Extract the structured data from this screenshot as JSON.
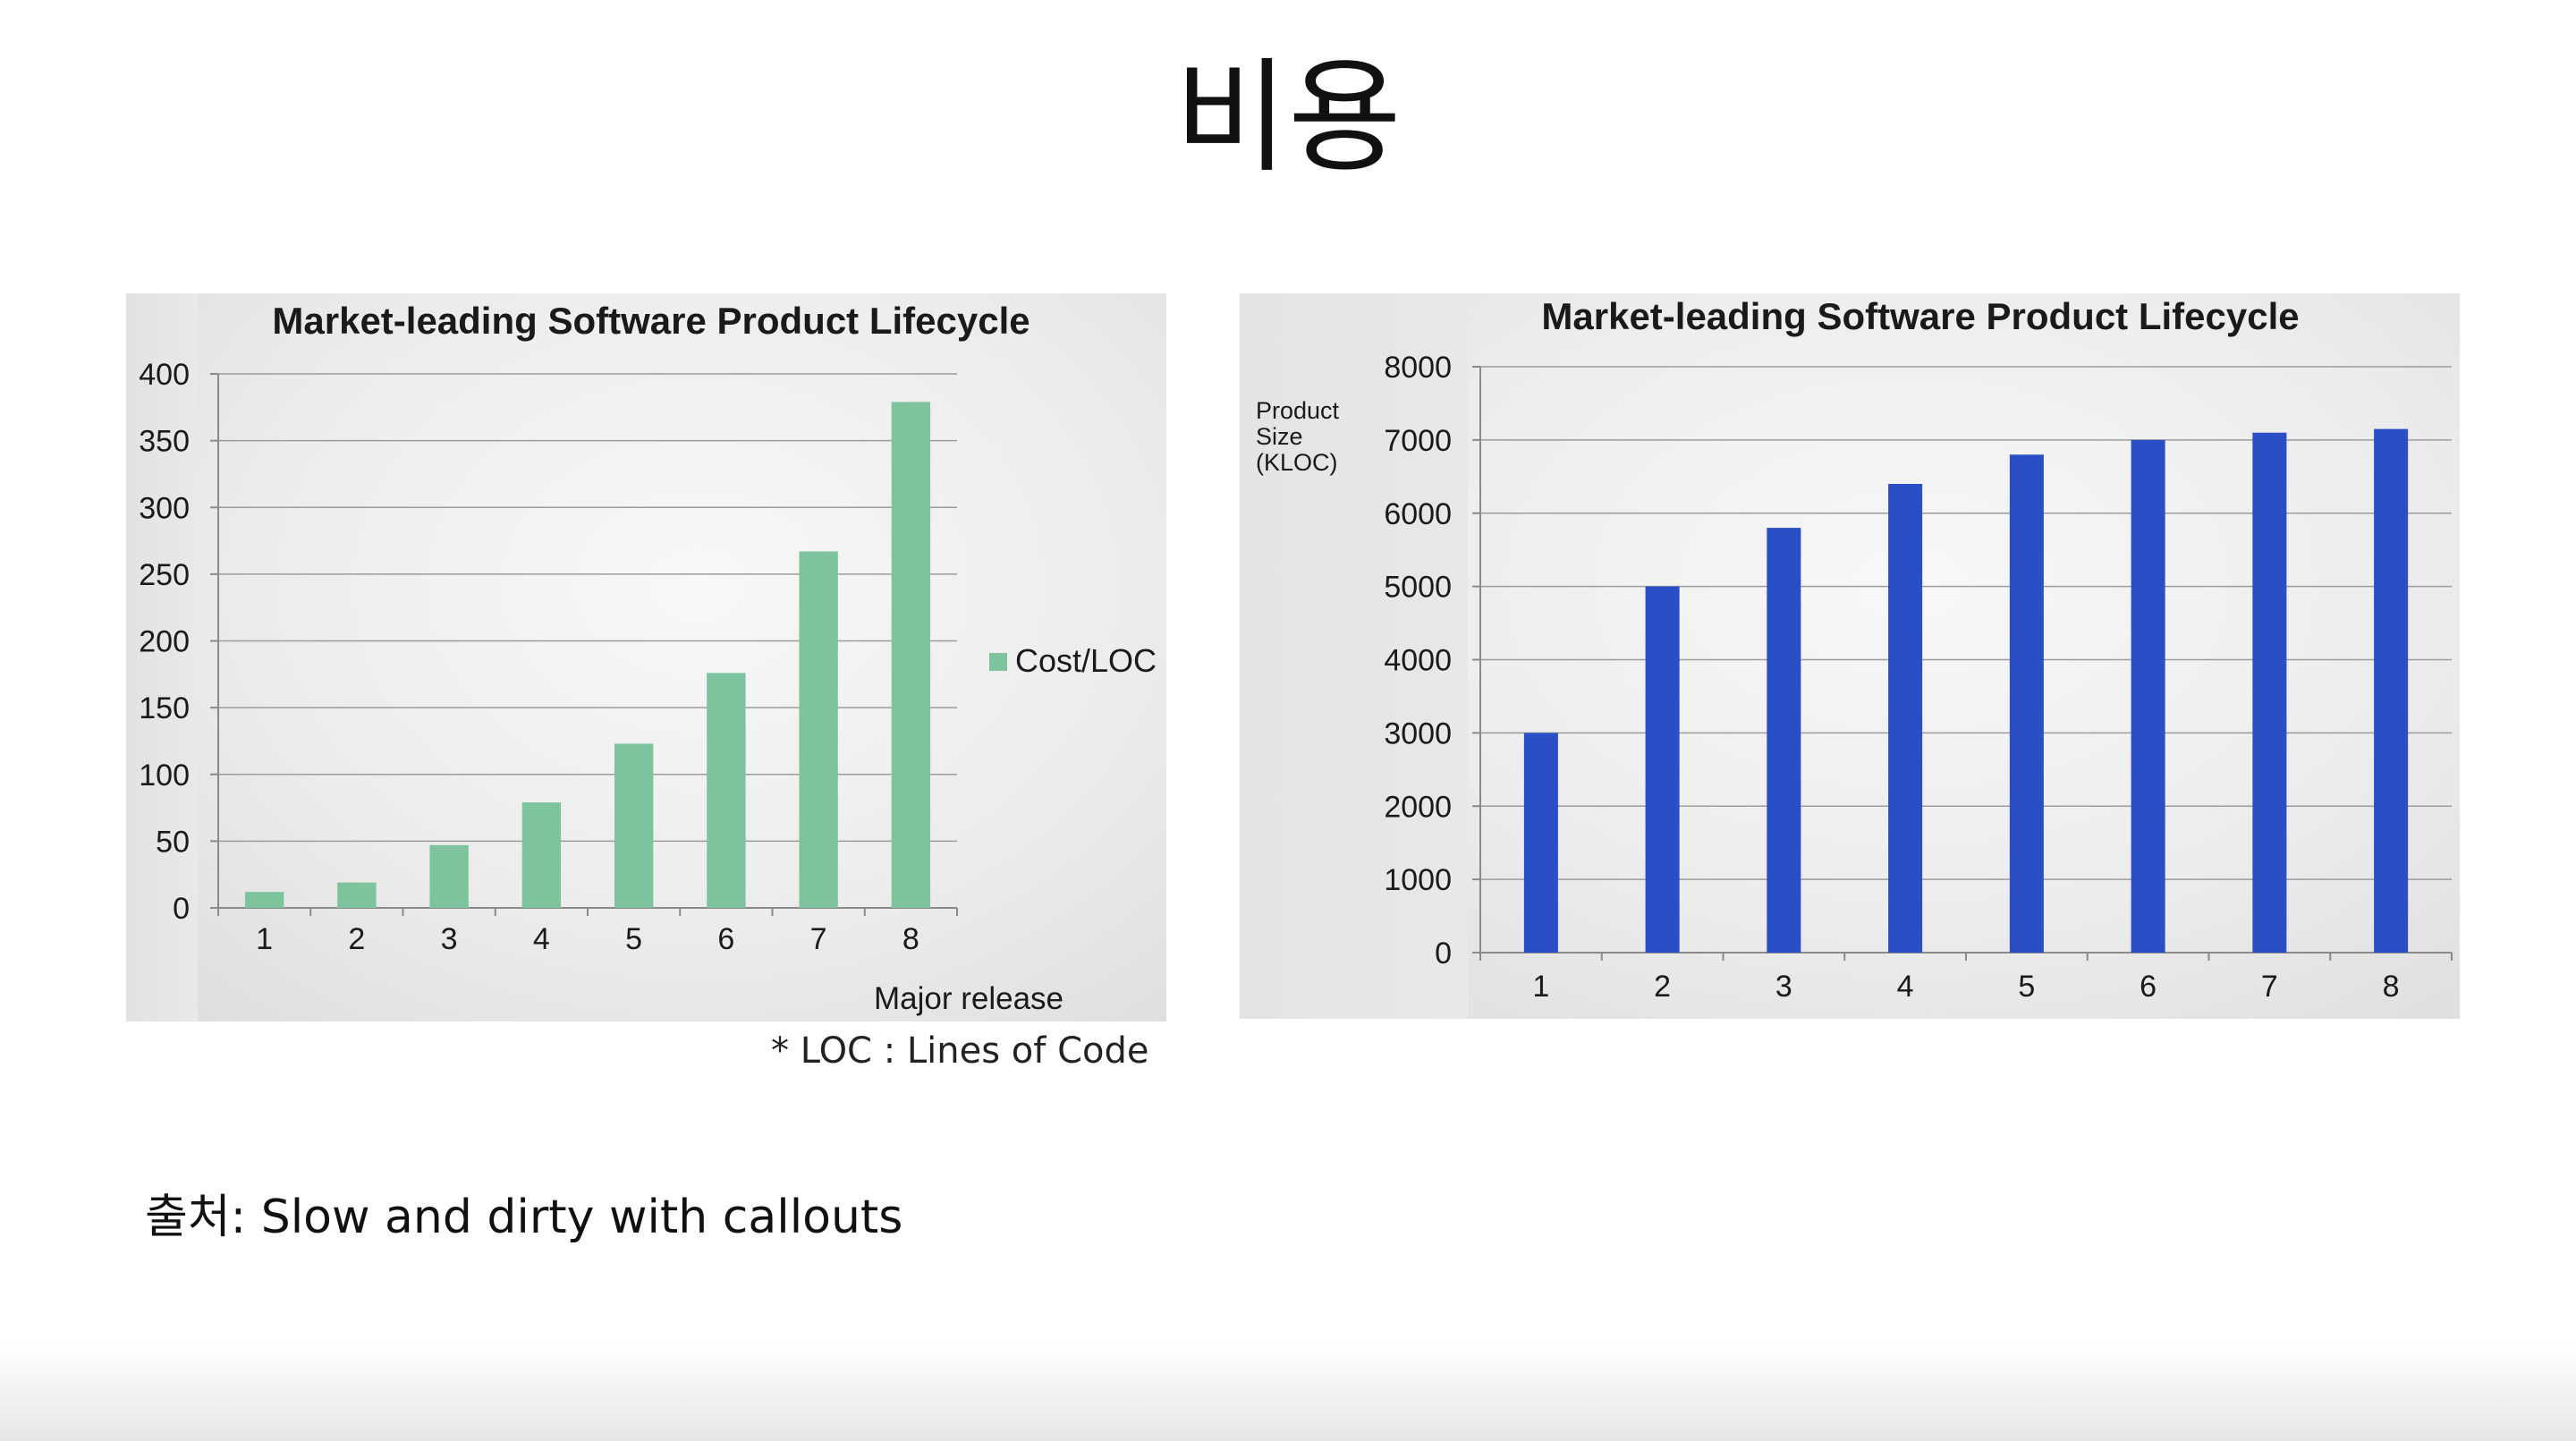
{
  "slide": {
    "title": "비용",
    "footnote": "* LOC : Lines of Code",
    "source": "출처: Slow and dirty with callouts"
  },
  "chart_data": [
    {
      "type": "bar",
      "title": "Market-leading Software Product Lifecycle",
      "xlabel": "Major release",
      "ylabel": "",
      "categories": [
        "1",
        "2",
        "3",
        "4",
        "5",
        "6",
        "7",
        "8"
      ],
      "series": [
        {
          "name": "Cost/LOC",
          "values": [
            12,
            19,
            47,
            79,
            123,
            176,
            267,
            379
          ],
          "color": "#7dc49d"
        }
      ],
      "ylim": [
        0,
        400
      ],
      "yticks": [
        "0",
        "50",
        "100",
        "150",
        "200",
        "250",
        "300",
        "350",
        "400"
      ],
      "grid": true,
      "legend": "right"
    },
    {
      "type": "bar",
      "title": "Market-leading Software Product Lifecycle",
      "xlabel": "",
      "ylabel": [
        "Product",
        "Size",
        "(KLOC)"
      ],
      "categories": [
        "1",
        "2",
        "3",
        "4",
        "5",
        "6",
        "7",
        "8"
      ],
      "series": [
        {
          "values": [
            3000,
            5000,
            5800,
            6400,
            6800,
            7000,
            7100,
            7150
          ],
          "color": "#2a4ec4"
        }
      ],
      "ylim": [
        0,
        8000
      ],
      "yticks": [
        "0",
        "1000",
        "2000",
        "3000",
        "4000",
        "5000",
        "6000",
        "7000",
        "8000"
      ],
      "grid": true,
      "legend": "none"
    }
  ]
}
